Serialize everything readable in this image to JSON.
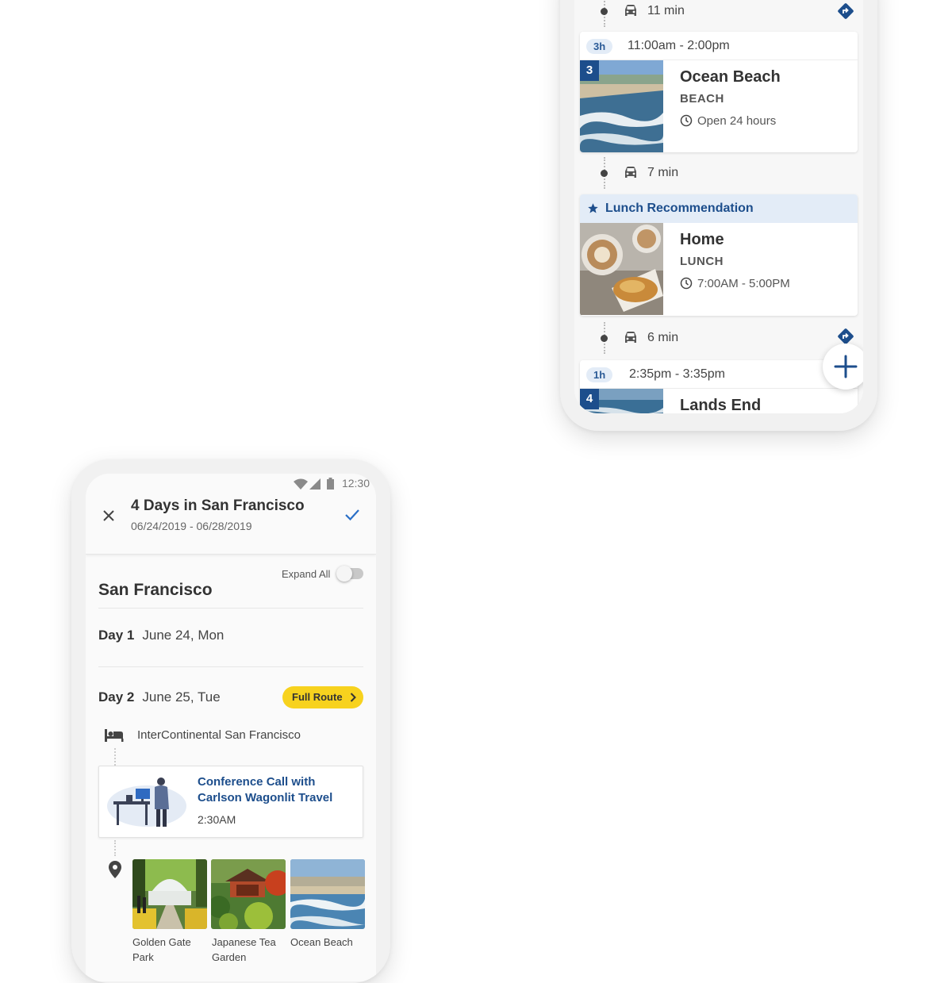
{
  "itinerary_phone": {
    "route_1": {
      "duration": "11 min"
    },
    "stop_3": {
      "duration_pill": "3h",
      "hours_range": "11:00am - 2:00pm",
      "number": "3",
      "name": "Ocean Beach",
      "type": "BEACH",
      "open_hours": "Open 24 hours"
    },
    "route_2": {
      "duration": "7 min"
    },
    "lunch": {
      "recommendation_label": "Lunch Recommendation",
      "name": "Home",
      "type": "LUNCH",
      "open_hours": "7:00AM - 5:00PM"
    },
    "route_3": {
      "duration": "6 min"
    },
    "stop_4": {
      "duration_pill": "1h",
      "hours_range": "2:35pm - 3:35pm",
      "number": "4",
      "name": "Lands End"
    },
    "fab_icon": "plus-icon"
  },
  "trip_phone": {
    "status_time": "12:30",
    "trip_title": "4 Days in San Francisco",
    "trip_dates": "06/24/2019 - 06/28/2019",
    "expand_all_label": "Expand All",
    "expand_all_on": false,
    "city": "San Francisco",
    "day1": {
      "label": "Day 1",
      "date": "June 24, Mon"
    },
    "day2": {
      "label": "Day 2",
      "date": "June 25, Tue"
    },
    "full_route_label": "Full Route",
    "hotel": "InterContinental San Francisco",
    "event": {
      "title": "Conference Call with Carlson Wagonlit Travel",
      "time": "2:30AM"
    },
    "places": [
      {
        "label": "Golden Gate Park"
      },
      {
        "label": "Japanese Tea Garden"
      },
      {
        "label": "Ocean Beach"
      }
    ]
  },
  "colors": {
    "accent_blue": "#1d4e8c",
    "route_yellow": "#f7d21e",
    "pill_bg": "#e3ecf7"
  }
}
